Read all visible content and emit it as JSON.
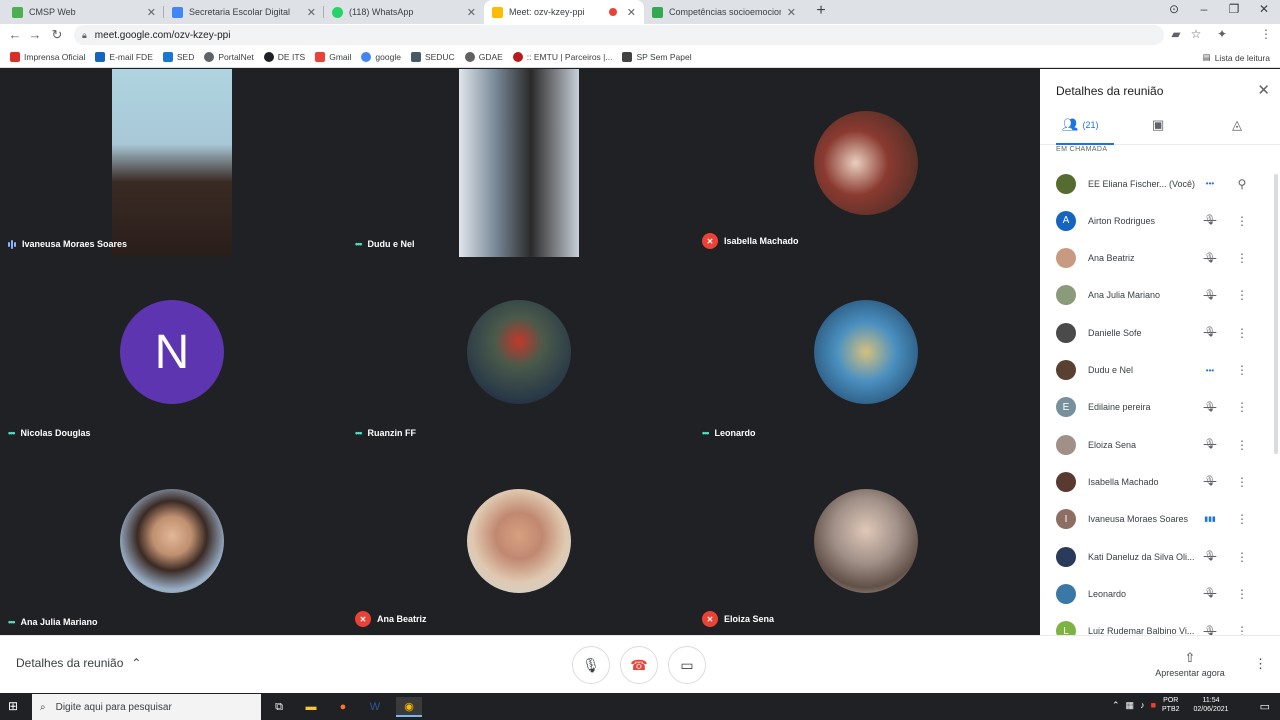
{
  "browser": {
    "tabs": [
      {
        "title": "CMSP Web",
        "color": "#4caf50",
        "active": false
      },
      {
        "title": "Secretaria Escolar Digital",
        "color": "#4285f4",
        "active": false
      },
      {
        "title": "(118) WhatsApp",
        "color": "#25d366",
        "active": false
      },
      {
        "title": "Meet: ozv-kzey-ppi",
        "color": "#fbbc04",
        "active": true
      },
      {
        "title": "Competências socioemocionais d",
        "color": "#34a853",
        "active": false
      }
    ],
    "url": "meet.google.com/ozv-kzey-ppi",
    "bookmarks": [
      {
        "label": "Imprensa Oficial",
        "color": "#d93025"
      },
      {
        "label": "E-mail FDE",
        "color": "#1565c0"
      },
      {
        "label": "SED",
        "color": "#1976d2"
      },
      {
        "label": "PortalNet",
        "color": "#5f6368"
      },
      {
        "label": "DE ITS",
        "color": "#202124"
      },
      {
        "label": "Gmail",
        "color": "#ea4335"
      },
      {
        "label": "google",
        "color": "#4285f4"
      },
      {
        "label": "SEDUC",
        "color": "#455a64"
      },
      {
        "label": "GDAE",
        "color": "#616161"
      },
      {
        "label": ":: EMTU | Parceiros |...",
        "color": "#b71c1c"
      },
      {
        "label": "SP Sem Papel",
        "color": "#424242"
      }
    ],
    "reading_list": "Lista de leitura"
  },
  "tiles": [
    {
      "name": "Ivaneusa Moraes Soares",
      "status": "speaking",
      "kind": "camera",
      "bg": "#a8c8d8"
    },
    {
      "name": "Dudu e Nel",
      "status": "dots",
      "kind": "camera",
      "bg": "#7a8a99"
    },
    {
      "name": "Isabella Machado",
      "status": "muted",
      "kind": "photo",
      "bg": "#5a3a30"
    },
    {
      "name": "Nicolas Douglas",
      "status": "dots",
      "kind": "letter",
      "letter": "N",
      "bg": "#5e35b1"
    },
    {
      "name": "Ruanzin FF",
      "status": "dots",
      "kind": "photo",
      "bg": "#3a4550"
    },
    {
      "name": "Leonardo",
      "status": "dots",
      "kind": "photo",
      "bg": "#3a78a8"
    },
    {
      "name": "Ana Julia Mariano",
      "status": "dots",
      "kind": "photo",
      "bg": "#8a9a7a"
    },
    {
      "name": "Ana Beatriz",
      "status": "muted",
      "kind": "photo",
      "bg": "#c89a80"
    },
    {
      "name": "Eloiza Sena",
      "status": "muted",
      "kind": "photo",
      "bg": "#a09088"
    }
  ],
  "panel": {
    "title": "Detalhes da reunião",
    "people_count": "(21)",
    "section": "EM CHAMADA",
    "participants": [
      {
        "name": "EE Eliana Fischer... (Você)",
        "letter": "",
        "color": "#556b2f",
        "status": "dots"
      },
      {
        "name": "Airton Rodrigues",
        "letter": "A",
        "color": "#1565c0",
        "status": "muted"
      },
      {
        "name": "Ana Beatriz",
        "letter": "",
        "color": "#c89a80",
        "status": "muted"
      },
      {
        "name": "Ana Julia Mariano",
        "letter": "",
        "color": "#8a9a7a",
        "status": "muted"
      },
      {
        "name": "Danielle Sofe",
        "letter": "",
        "color": "#4a4a4a",
        "status": "muted"
      },
      {
        "name": "Dudu e Nel",
        "letter": "",
        "color": "#5a4030",
        "status": "dots"
      },
      {
        "name": "Edilaine pereira",
        "letter": "E",
        "color": "#78909c",
        "status": "muted"
      },
      {
        "name": "Eloiza Sena",
        "letter": "",
        "color": "#a09088",
        "status": "muted"
      },
      {
        "name": "Isabella Machado",
        "letter": "",
        "color": "#5a3a30",
        "status": "muted"
      },
      {
        "name": "Ivaneusa Moraes Soares",
        "letter": "I",
        "color": "#8d6e63",
        "status": "speaking"
      },
      {
        "name": "Kati Daneluz da Silva Oli...",
        "letter": "",
        "color": "#2a3a5a",
        "status": "muted"
      },
      {
        "name": "Leonardo",
        "letter": "",
        "color": "#3a78a8",
        "status": "muted"
      },
      {
        "name": "Luiz Rudemar Balbino Vi...",
        "letter": "L",
        "color": "#7cb342",
        "status": "muted"
      }
    ]
  },
  "bottom": {
    "meeting_details": "Detalhes da reunião",
    "present_now": "Apresentar agora"
  },
  "taskbar": {
    "search_placeholder": "Digite aqui para pesquisar",
    "lang_top": "POR",
    "lang_bottom": "PTB2",
    "time": "11:54",
    "date": "02/06/2021"
  }
}
